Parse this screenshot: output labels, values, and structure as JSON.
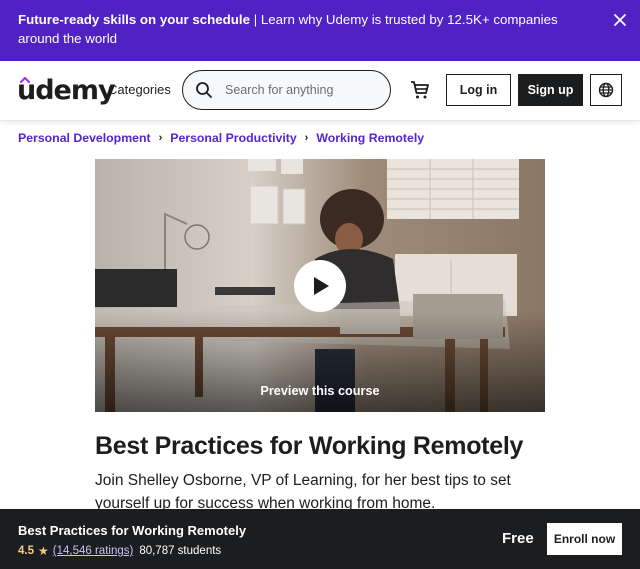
{
  "banner": {
    "bold_text": "Future-ready skills on your schedule",
    "separator": " | ",
    "text": "Learn why Udemy is trusted by 12.5K+ companies around the world",
    "close_icon": "close-icon"
  },
  "header": {
    "logo": "udemy",
    "categories_label": "Categories",
    "search": {
      "placeholder": "Search for anything",
      "value": "",
      "icon": "search-icon"
    },
    "cart_icon": "cart-icon",
    "login_label": "Log in",
    "signup_label": "Sign up",
    "language_icon": "globe-icon"
  },
  "breadcrumb": {
    "items": [
      {
        "label": "Personal Development"
      },
      {
        "label": "Personal Productivity"
      },
      {
        "label": "Working Remotely"
      }
    ],
    "separator": "›"
  },
  "preview": {
    "label": "Preview this course",
    "play_icon": "play-icon"
  },
  "course": {
    "title": "Best Practices for Working Remotely",
    "description": "Join Shelley Osborne, VP of Learning, for her best tips to set yourself up for success when working from home."
  },
  "sticky_bar": {
    "title": "Best Practices for Working Remotely",
    "rating": "4.5",
    "star_icon": "★",
    "ratings_count": "(14,546 ratings)",
    "students": "80,787 students",
    "price": "Free",
    "enroll_label": "Enroll now"
  },
  "colors": {
    "brand_purple": "#5022c3",
    "link_purple": "#5624d0",
    "dark": "#1c1d1f",
    "rating_gold": "#f3ca8c",
    "ratings_link": "#c0c4fc"
  }
}
